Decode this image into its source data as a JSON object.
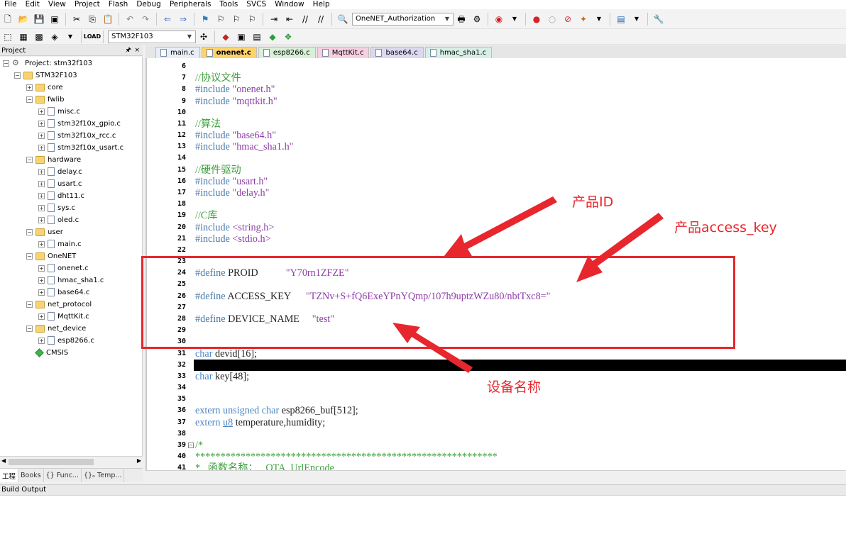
{
  "menu": [
    "File",
    "Edit",
    "View",
    "Project",
    "Flash",
    "Debug",
    "Peripherals",
    "Tools",
    "SVCS",
    "Window",
    "Help"
  ],
  "toolbar": {
    "target_combo": "OneNET_Authorization",
    "device_combo": "STM32F103"
  },
  "project_pane": {
    "title": "Project",
    "pin": "🖈",
    "close": "×",
    "root": "Project: stm32f103",
    "target": "STM32F103",
    "groups": [
      {
        "name": "core",
        "expanded": false,
        "files": []
      },
      {
        "name": "fwlib",
        "expanded": true,
        "files": [
          "misc.c",
          "stm32f10x_gpio.c",
          "stm32f10x_rcc.c",
          "stm32f10x_usart.c"
        ]
      },
      {
        "name": "hardware",
        "expanded": true,
        "files": [
          "delay.c",
          "usart.c",
          "dht11.c",
          "sys.c",
          "oled.c"
        ]
      },
      {
        "name": "user",
        "expanded": true,
        "files": [
          "main.c"
        ]
      },
      {
        "name": "OneNET",
        "expanded": true,
        "files": [
          "onenet.c",
          "hmac_sha1.c",
          "base64.c"
        ]
      },
      {
        "name": "net_protocol",
        "expanded": true,
        "files": [
          "MqttKit.c"
        ]
      },
      {
        "name": "net_device",
        "expanded": true,
        "files": [
          "esp8266.c"
        ]
      }
    ],
    "cmsis": "CMSIS",
    "bottom_tabs": [
      "工程",
      "Books",
      "{} Func...",
      "{}ₒ Temp..."
    ]
  },
  "editor_tabs": [
    {
      "label": "main.c",
      "color": "#e8eef6",
      "active": false
    },
    {
      "label": "onenet.c",
      "color": "#ffd36b",
      "active": true
    },
    {
      "label": "esp8266.c",
      "color": "#d8efd8",
      "active": false
    },
    {
      "label": "MqttKit.c",
      "color": "#f7cfe1",
      "active": false
    },
    {
      "label": "base64.c",
      "color": "#dcd8f0",
      "active": false
    },
    {
      "label": "hmac_sha1.c",
      "color": "#d8efe6",
      "active": false
    }
  ],
  "code_lines": [
    {
      "n": "6",
      "parts": []
    },
    {
      "n": "7",
      "parts": [
        {
          "t": "//协议文件",
          "c": "cmt"
        }
      ]
    },
    {
      "n": "8",
      "parts": [
        {
          "t": "#include ",
          "c": "pp"
        },
        {
          "t": "\"onenet.h\"",
          "c": "str"
        }
      ]
    },
    {
      "n": "9",
      "parts": [
        {
          "t": "#include ",
          "c": "pp"
        },
        {
          "t": "\"mqttkit.h\"",
          "c": "str"
        }
      ]
    },
    {
      "n": "10",
      "parts": []
    },
    {
      "n": "11",
      "parts": [
        {
          "t": "//算法",
          "c": "cmt"
        }
      ]
    },
    {
      "n": "12",
      "parts": [
        {
          "t": "#include ",
          "c": "pp"
        },
        {
          "t": "\"base64.h\"",
          "c": "str"
        }
      ]
    },
    {
      "n": "13",
      "parts": [
        {
          "t": "#include ",
          "c": "pp"
        },
        {
          "t": "\"hmac_sha1.h\"",
          "c": "str"
        }
      ]
    },
    {
      "n": "14",
      "parts": []
    },
    {
      "n": "15",
      "parts": [
        {
          "t": "//硬件驱动",
          "c": "cmt"
        }
      ]
    },
    {
      "n": "16",
      "parts": [
        {
          "t": "#include ",
          "c": "pp"
        },
        {
          "t": "\"usart.h\"",
          "c": "str"
        }
      ]
    },
    {
      "n": "17",
      "parts": [
        {
          "t": "#include ",
          "c": "pp"
        },
        {
          "t": "\"delay.h\"",
          "c": "str"
        }
      ]
    },
    {
      "n": "18",
      "parts": []
    },
    {
      "n": "19",
      "parts": [
        {
          "t": "//C库",
          "c": "cmt"
        }
      ]
    },
    {
      "n": "20",
      "parts": [
        {
          "t": "#include ",
          "c": "pp"
        },
        {
          "t": "<string.h>",
          "c": "str"
        }
      ]
    },
    {
      "n": "21",
      "parts": [
        {
          "t": "#include ",
          "c": "pp"
        },
        {
          "t": "<stdio.h>",
          "c": "str"
        }
      ]
    },
    {
      "n": "22",
      "parts": []
    },
    {
      "n": "23",
      "parts": []
    },
    {
      "n": "24",
      "parts": [
        {
          "t": "#define ",
          "c": "pp"
        },
        {
          "t": "PROID           ",
          "c": "txt"
        },
        {
          "t": "\"Y70rn1ZFZE\"",
          "c": "str"
        }
      ]
    },
    {
      "n": "25",
      "parts": []
    },
    {
      "n": "26",
      "parts": [
        {
          "t": "#define ",
          "c": "pp"
        },
        {
          "t": "ACCESS_KEY      ",
          "c": "txt"
        },
        {
          "t": "\"TZNv+S+fQ6ExeYPnYQmp/107h9uptzWZu80/nbtTxc8=\"",
          "c": "str"
        }
      ]
    },
    {
      "n": "27",
      "parts": []
    },
    {
      "n": "28",
      "parts": [
        {
          "t": "#define ",
          "c": "pp"
        },
        {
          "t": "DEVICE_NAME     ",
          "c": "txt"
        },
        {
          "t": "\"test\"",
          "c": "str"
        }
      ]
    },
    {
      "n": "29",
      "parts": []
    },
    {
      "n": "30",
      "parts": []
    },
    {
      "n": "31",
      "parts": [
        {
          "t": "char ",
          "c": "kw"
        },
        {
          "t": "devid[16];",
          "c": "txt"
        }
      ]
    },
    {
      "n": "32",
      "parts": []
    },
    {
      "n": "33",
      "parts": [
        {
          "t": "char ",
          "c": "kw"
        },
        {
          "t": "key[48];",
          "c": "txt"
        }
      ]
    },
    {
      "n": "34",
      "parts": []
    },
    {
      "n": "35",
      "parts": []
    },
    {
      "n": "36",
      "parts": [
        {
          "t": "extern unsigned char ",
          "c": "kw"
        },
        {
          "t": "esp8266_buf[512];",
          "c": "txt"
        }
      ]
    },
    {
      "n": "37",
      "parts": [
        {
          "t": "extern ",
          "c": "kw"
        },
        {
          "t": "u8",
          "c": "kw"
        },
        {
          "t": " temperature,humidity;",
          "c": "txt"
        }
      ]
    },
    {
      "n": "38",
      "parts": []
    },
    {
      "n": "39",
      "parts": [
        {
          "t": "/*",
          "c": "cmt"
        }
      ]
    },
    {
      "n": "40",
      "parts": [
        {
          "t": "************************************************************",
          "c": "cmt"
        }
      ]
    },
    {
      "n": "41",
      "parts": [
        {
          "t": "*   函数名称：   OTA_UrlEncode",
          "c": "cmt"
        }
      ]
    }
  ],
  "build_output": {
    "title": "Build Output"
  },
  "annotations": {
    "product_id": "产品ID",
    "access_key": "产品access_key",
    "device_name": "设备名称",
    "color": "#e8262d"
  }
}
